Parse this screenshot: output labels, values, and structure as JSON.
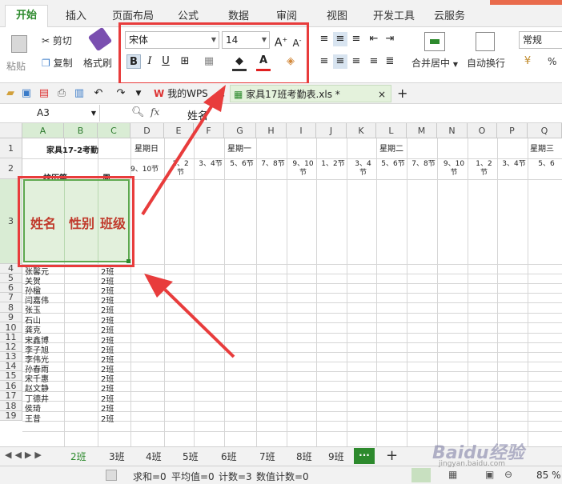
{
  "menubar": {
    "tabs": [
      "开始",
      "插入",
      "页面布局",
      "公式",
      "数据",
      "审阅",
      "视图",
      "开发工具",
      "云服务"
    ]
  },
  "ribbon": {
    "paste": "粘贴",
    "cut": "剪切",
    "copy": "复制",
    "format_painter": "格式刷",
    "font_name": "宋体",
    "font_size": "14",
    "bold": "B",
    "italic": "I",
    "underline": "U",
    "font_color_letter": "A",
    "merge_center": "合并居中",
    "wrap_text": "自动换行",
    "number_format": "常规",
    "percent": "%"
  },
  "tabs_bar": {
    "wps_tab": "我的WPS",
    "file_tab": "家具17班考勤表.xls *",
    "add": "+"
  },
  "formula_bar": {
    "cell_ref": "A3",
    "fx": "fx",
    "content": "姓名"
  },
  "columns": [
    "A",
    "B",
    "C",
    "D",
    "E",
    "F",
    "G",
    "H",
    "I",
    "J",
    "K",
    "L",
    "M",
    "N",
    "O",
    "P",
    "Q"
  ],
  "header": {
    "title": "家具17-2考勤",
    "row2_a": "校历第",
    "row2_c": "周",
    "day_d": "星期日",
    "day1": "星期一",
    "day2": "星期二",
    "day3": "星期三",
    "d_periods": "9、10节",
    "periods": [
      "1、2节",
      "3、4节",
      "5、6节",
      "7、8节",
      "9、10节",
      "1、2节",
      "3、4节",
      "5、6节",
      "7、8节",
      "9、10节",
      "1、2节",
      "3、4节",
      "5、6"
    ]
  },
  "row3": {
    "name": "姓名",
    "gender": "性别",
    "class": "班级"
  },
  "rows": [
    {
      "num": "4",
      "name": "张馨元",
      "cls": "2班"
    },
    {
      "num": "5",
      "name": "关贺",
      "cls": "2班"
    },
    {
      "num": "6",
      "name": "孙楹",
      "cls": "2班"
    },
    {
      "num": "7",
      "name": "闫嘉伟",
      "cls": "2班"
    },
    {
      "num": "8",
      "name": "张玉",
      "cls": "2班"
    },
    {
      "num": "9",
      "name": "石山",
      "cls": "2班"
    },
    {
      "num": "10",
      "name": "龚克",
      "cls": "2班"
    },
    {
      "num": "11",
      "name": "宋鑫博",
      "cls": "2班"
    },
    {
      "num": "12",
      "name": "李子旭",
      "cls": "2班"
    },
    {
      "num": "13",
      "name": "李伟光",
      "cls": "2班"
    },
    {
      "num": "14",
      "name": "孙春雨",
      "cls": "2班"
    },
    {
      "num": "15",
      "name": "宋千惠",
      "cls": "2班"
    },
    {
      "num": "16",
      "name": "赵文静",
      "cls": "2班"
    },
    {
      "num": "17",
      "name": "丁德井",
      "cls": "2班"
    },
    {
      "num": "18",
      "name": "侯琦",
      "cls": "2班"
    },
    {
      "num": "19",
      "name": "王昔",
      "cls": "2班"
    }
  ],
  "row_nums_top": [
    "1",
    "2",
    "3"
  ],
  "sheets": [
    "2班",
    "3班",
    "4班",
    "5班",
    "6班",
    "7班",
    "8班",
    "9班"
  ],
  "status": {
    "sum": "求和=0",
    "avg": "平均值=0",
    "count": "计数=3",
    "numcount": "数值计数=0",
    "zoom": "85 %"
  },
  "watermark": "Baidu经验",
  "watermark_url": "jingyan.baidu.com",
  "colors": {
    "accent": "#2d8a2d",
    "highlight": "#e83c3c",
    "selection": "#e2f0dc",
    "red_text": "#c0392b"
  }
}
